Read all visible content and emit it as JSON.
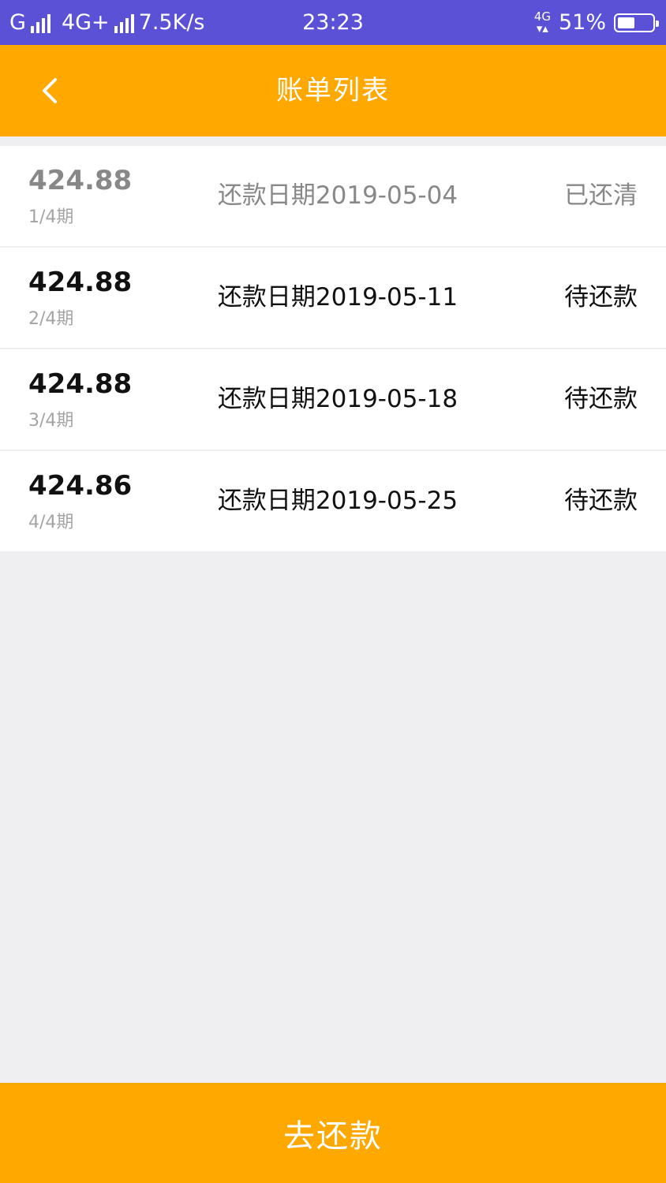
{
  "status_bar": {
    "carrier_left": "G",
    "network": "4G+",
    "speed": "7.5K/s",
    "time": "23:23",
    "network_right": "4G",
    "battery": "51%",
    "battery_level": 0.51
  },
  "nav": {
    "title": "账单列表"
  },
  "bills": [
    {
      "amount": "424.88",
      "period": "1/4期",
      "due": "还款日期2019-05-04",
      "status": "已还清"
    },
    {
      "amount": "424.88",
      "period": "2/4期",
      "due": "还款日期2019-05-11",
      "status": "待还款"
    },
    {
      "amount": "424.88",
      "period": "3/4期",
      "due": "还款日期2019-05-18",
      "status": "待还款"
    },
    {
      "amount": "424.86",
      "period": "4/4期",
      "due": "还款日期2019-05-25",
      "status": "待还款"
    }
  ],
  "footer": {
    "pay_label": "去还款"
  },
  "colors": {
    "status_bar": "#5a51d6",
    "accent": "#ffa800",
    "background": "#efeef1"
  }
}
